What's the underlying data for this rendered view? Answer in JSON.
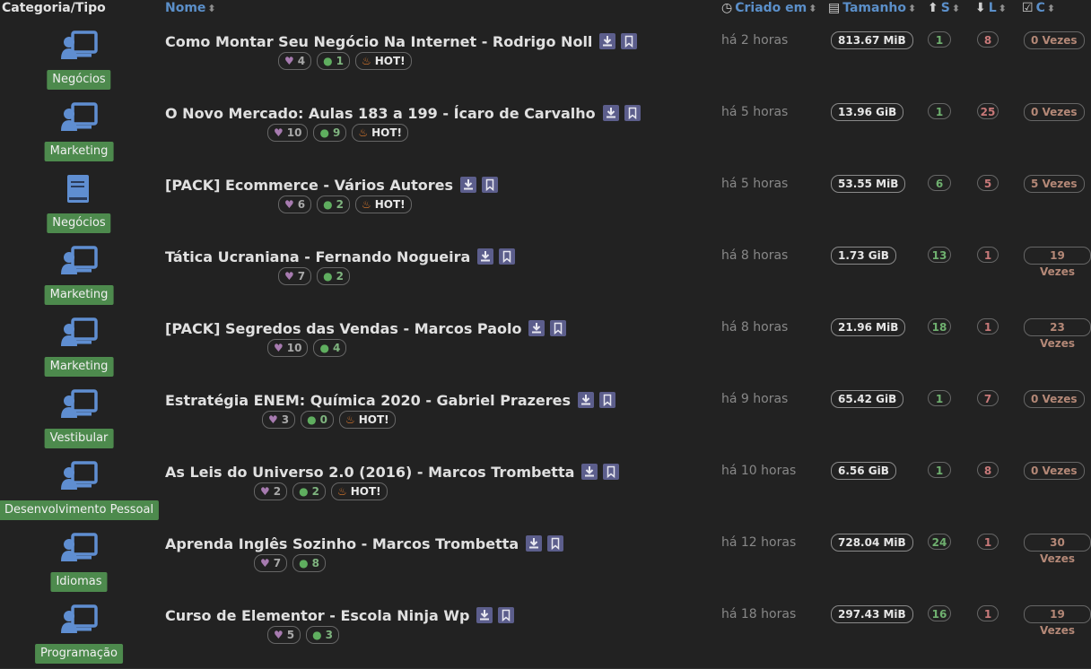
{
  "header": {
    "category": "Categoria/Tipo",
    "name": "Nome",
    "created": "Criado em",
    "size": "Tamanho",
    "seeders": "S",
    "leechers": "L",
    "completed": "C"
  },
  "hot_label": "HOT!",
  "rows": [
    {
      "category": "Negócios",
      "icon": "monitor-user-icon",
      "title": "Como Montar Seu Negócio Na Internet - Rodrigo Noll",
      "likes": "4",
      "comments": "1",
      "hot": true,
      "created": "há 2 horas",
      "size": "813.67 MiB",
      "seeders": "1",
      "leechers": "8",
      "completed": "0 Vezes"
    },
    {
      "category": "Marketing",
      "icon": "monitor-user-icon",
      "title": "O Novo Mercado: Aulas 183 a 199 - Ícaro de Carvalho",
      "likes": "10",
      "comments": "9",
      "hot": true,
      "created": "há 5 horas",
      "size": "13.96 GiB",
      "seeders": "1",
      "leechers": "25",
      "completed": "0 Vezes"
    },
    {
      "category": "Negócios",
      "icon": "book-icon",
      "title": "[PACK] Ecommerce - Vários Autores",
      "likes": "6",
      "comments": "2",
      "hot": true,
      "created": "há 5 horas",
      "size": "53.55 MiB",
      "seeders": "6",
      "leechers": "5",
      "completed": "5 Vezes"
    },
    {
      "category": "Marketing",
      "icon": "monitor-user-icon",
      "title": "Tática Ucraniana - Fernando Nogueira",
      "likes": "7",
      "comments": "2",
      "hot": false,
      "created": "há 8 horas",
      "size": "1.73 GiB",
      "seeders": "13",
      "leechers": "1",
      "completed": "19 Vezes"
    },
    {
      "category": "Marketing",
      "icon": "monitor-user-icon",
      "title": "[PACK] Segredos das Vendas - Marcos Paolo",
      "likes": "10",
      "comments": "4",
      "hot": false,
      "created": "há 8 horas",
      "size": "21.96 MiB",
      "seeders": "18",
      "leechers": "1",
      "completed": "23 Vezes"
    },
    {
      "category": "Vestibular",
      "icon": "monitor-user-icon",
      "title": "Estratégia ENEM: Química 2020 - Gabriel Prazeres",
      "likes": "3",
      "comments": "0",
      "hot": true,
      "created": "há 9 horas",
      "size": "65.42 GiB",
      "seeders": "1",
      "leechers": "7",
      "completed": "0 Vezes"
    },
    {
      "category": "Desenvolvimento Pessoal",
      "icon": "monitor-user-icon",
      "title": "As Leis do Universo 2.0 (2016) - Marcos Trombetta",
      "likes": "2",
      "comments": "2",
      "hot": true,
      "created": "há 10 horas",
      "size": "6.56 GiB",
      "seeders": "1",
      "leechers": "8",
      "completed": "0 Vezes"
    },
    {
      "category": "Idiomas",
      "icon": "monitor-user-icon",
      "title": "Aprenda Inglês Sozinho - Marcos Trombetta",
      "likes": "7",
      "comments": "8",
      "hot": false,
      "created": "há 12 horas",
      "size": "728.04 MiB",
      "seeders": "24",
      "leechers": "1",
      "completed": "30 Vezes"
    },
    {
      "category": "Programação",
      "icon": "monitor-user-icon",
      "title": "Curso de Elementor - Escola Ninja Wp",
      "likes": "5",
      "comments": "3",
      "hot": false,
      "created": "há 18 horas",
      "size": "297.43 MiB",
      "seeders": "16",
      "leechers": "1",
      "completed": "19 Vezes"
    }
  ]
}
